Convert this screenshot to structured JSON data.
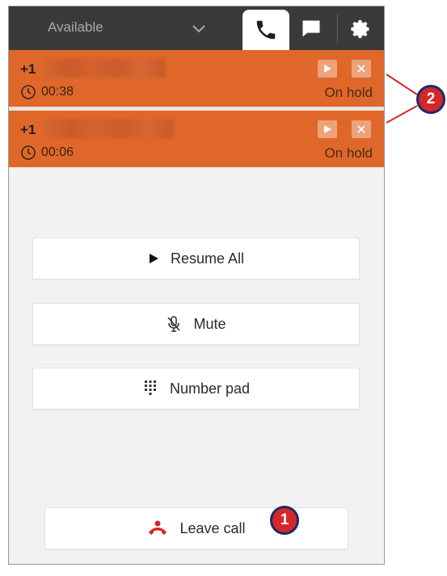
{
  "header": {
    "status": "Available",
    "tabs": [
      {
        "icon": "phone-icon",
        "active": true
      },
      {
        "icon": "chat-icon",
        "active": false
      },
      {
        "icon": "gear-icon",
        "active": false
      }
    ]
  },
  "calls": [
    {
      "number_prefix": "+1",
      "duration": "00:38",
      "state": "On hold"
    },
    {
      "number_prefix": "+1",
      "duration": "00:06",
      "state": "On hold"
    }
  ],
  "actions": {
    "resume_all": "Resume All",
    "mute": "Mute",
    "number_pad": "Number pad",
    "leave_call": "Leave call"
  },
  "callouts": {
    "leave": "1",
    "calls": "2"
  },
  "colors": {
    "topbar": "#3a3a3a",
    "call_row": "#e0672a",
    "badge": "#d42727",
    "badge_border": "#1c2b6b",
    "leave_icon": "#d42727"
  }
}
